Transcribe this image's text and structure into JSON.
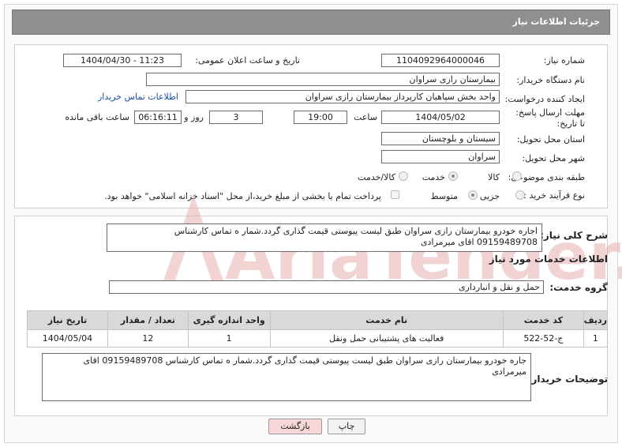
{
  "header": {
    "title": "جزئیات اطلاعات نیاز"
  },
  "form": {
    "need_number_label": "شماره نیاز:",
    "need_number": "1104092964000046",
    "announce_label": "تاریخ و ساعت اعلان عمومی:",
    "announce_value": "1404/04/30 - 11:23",
    "buyer_label": "نام دستگاه خریدار:",
    "buyer_value": "بیمارستان رازی سراوان",
    "creator_label": "ایجاد کننده درخواست:",
    "creator_value": "واحد بخش  سپاهیان کارپرداز بیمارستان رازی سراوان",
    "contact_link": "اطلاعات تماس خریدار",
    "deadline_label": "مهلت ارسال پاسخ: تا تاریخ:",
    "deadline_date": "1404/05/02",
    "time_label": "ساعت",
    "deadline_time": "19:00",
    "days_value": "3",
    "days_label": "روز و",
    "remaining_time": "06:16:11",
    "remaining_label": "ساعت باقی مانده",
    "province_label": "استان محل تحویل:",
    "province_value": "سیستان و بلوچستان",
    "city_label": "شهر محل تحویل:",
    "city_value": "سراوان",
    "category_label": "طبقه بندی موضوعی:",
    "category_options": [
      "کالا",
      "خدمت",
      "کالا/خدمت"
    ],
    "category_selected": "خدمت",
    "process_label": "نوع فرآیند خرید :",
    "process_options": [
      "جزیی",
      "متوسط"
    ],
    "process_selected": "متوسط",
    "payment_note": "پرداخت تمام یا بخشی از مبلغ خرید،از محل \"اسناد خزانه اسلامی\" خواهد بود."
  },
  "description": {
    "label": "شرح کلی نیاز:",
    "text": "اجاره خودرو بیمارستان رازی سراوان طبق لیست پیوستی قیمت گذاری گردد.شمار ه تماس کارشناس 09159489708 اقای میرمرادی"
  },
  "services": {
    "section_title": "اطلاعات خدمات مورد نیاز",
    "group_label": "گروه خدمت:",
    "group_value": "حمل و نقل و انبارداری",
    "columns": [
      "ردیف",
      "کد خدمت",
      "نام خدمت",
      "واحد اندازه گیری",
      "تعداد / مقدار",
      "تاریخ نیاز"
    ],
    "rows": [
      [
        "1",
        "ج-52-522",
        "فعالیت های پشتیبانی حمل ونقل",
        "1",
        "12",
        "1404/05/04"
      ]
    ]
  },
  "buyer_notes": {
    "label": "توضیحات خریدار:",
    "text": "جاره خودرو بیمارستان رازی سراوان طبق لیست پیوستی قیمت گذاری گردد.شمار ه تماس کارشناس 09159489708 اقای میرمرادی"
  },
  "actions": {
    "print": "چاپ",
    "back": "بازگشت"
  },
  "watermark": {
    "text": "AriaTender.net"
  },
  "colors": {
    "title_bar": "#8f8f8f",
    "link": "#1a4fa0",
    "back_button": "#f7d7d7",
    "watermark": "#e9b0b0"
  }
}
